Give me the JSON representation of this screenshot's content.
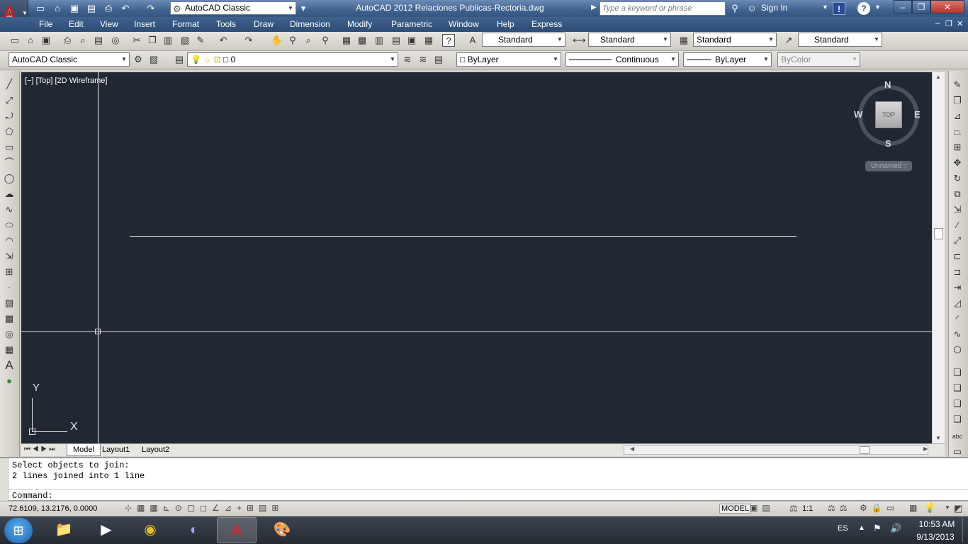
{
  "title_bar": {
    "app_letter": "A",
    "workspace": "AutoCAD Classic",
    "window_title": "AutoCAD 2012   Relaciones Publicas-Rectoria.dwg",
    "search_placeholder": "Type a keyword or phrase",
    "sign_in": "Sign In",
    "help": "?"
  },
  "menu": [
    "File",
    "Edit",
    "View",
    "Insert",
    "Format",
    "Tools",
    "Draw",
    "Dimension",
    "Modify",
    "Parametric",
    "Window",
    "Help",
    "Express"
  ],
  "styles_toolbar": {
    "text_style": "Standard",
    "dim_style": "Standard",
    "table_style": "Standard",
    "mleader_style": "Standard"
  },
  "layers_toolbar": {
    "workspace": "AutoCAD Classic",
    "layer": "0",
    "color": "ByLayer",
    "linetype": "Continuous",
    "lineweight": "ByLayer",
    "plotstyle": "ByColor"
  },
  "viewport": {
    "label": "[−] [Top] [2D Wireframe]",
    "viewcube_top": "TOP",
    "compass": {
      "n": "N",
      "s": "S",
      "e": "E",
      "w": "W"
    },
    "ucs_name": "Unnamed",
    "ucs_y": "Y",
    "ucs_x": "X"
  },
  "layout_tabs": [
    "Model",
    "Layout1",
    "Layout2"
  ],
  "command": {
    "line1": "Select objects to join:",
    "line2": "2 lines joined into 1 line",
    "prompt": "Command:"
  },
  "status": {
    "coords": "72.6109, 13.2176, 0.0000",
    "model": "MODEL",
    "scale": "1:1"
  },
  "taskbar": {
    "lang": "ES",
    "time": "10:53 AM",
    "date": "9/13/2013"
  }
}
